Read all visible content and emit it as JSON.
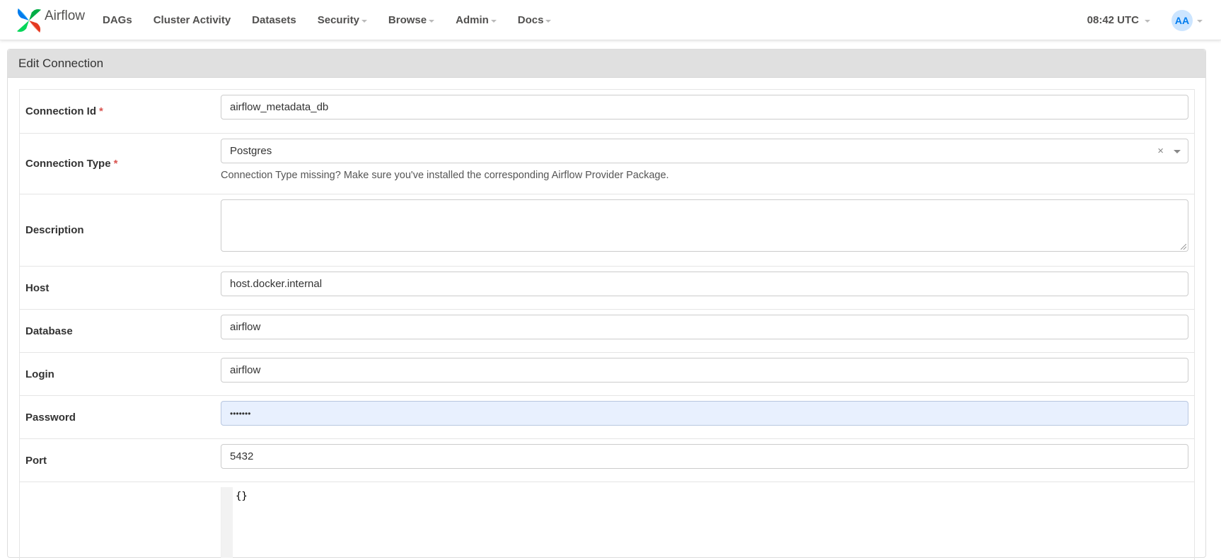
{
  "brand": {
    "name": "Airflow"
  },
  "nav": {
    "items": [
      {
        "label": "DAGs",
        "dropdown": false
      },
      {
        "label": "Cluster Activity",
        "dropdown": false
      },
      {
        "label": "Datasets",
        "dropdown": false
      },
      {
        "label": "Security",
        "dropdown": true
      },
      {
        "label": "Browse",
        "dropdown": true
      },
      {
        "label": "Admin",
        "dropdown": true
      },
      {
        "label": "Docs",
        "dropdown": true
      }
    ],
    "clock": "08:42 UTC",
    "user_initials": "AA"
  },
  "panel": {
    "title": "Edit Connection"
  },
  "form": {
    "connection_id": {
      "label": "Connection Id",
      "value": "airflow_metadata_db"
    },
    "connection_type": {
      "label": "Connection Type",
      "value": "Postgres",
      "clear": "×",
      "help": "Connection Type missing? Make sure you've installed the corresponding Airflow Provider Package."
    },
    "description": {
      "label": "Description",
      "value": ""
    },
    "host": {
      "label": "Host",
      "value": "host.docker.internal"
    },
    "database": {
      "label": "Database",
      "value": "airflow"
    },
    "login": {
      "label": "Login",
      "value": "airflow"
    },
    "password": {
      "label": "Password",
      "value": "•••••••"
    },
    "port": {
      "label": "Port",
      "value": "5432"
    },
    "extra": {
      "label": "",
      "value": "{}"
    },
    "required_mark": "*"
  },
  "colors": {
    "accent": "#017cee",
    "required": "#d9534f",
    "panel_heading": "#e0e0e0",
    "focused_input": "#e8f0fe"
  }
}
